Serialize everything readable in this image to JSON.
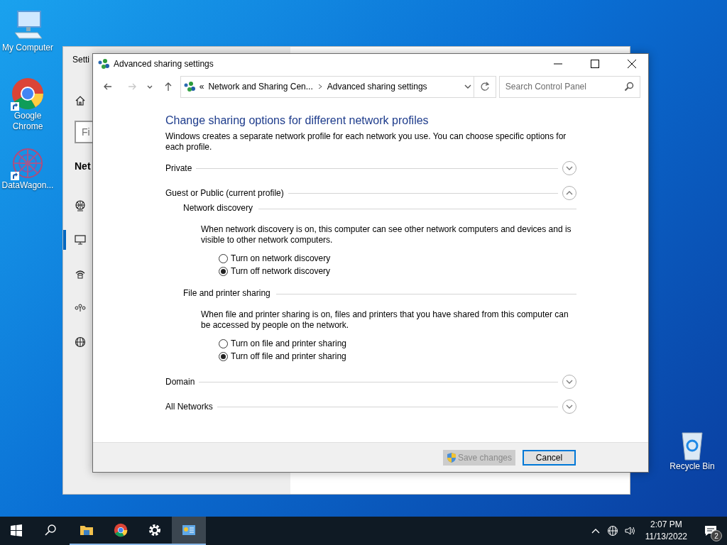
{
  "desktop_icons": [
    {
      "kind": "computer",
      "label": "My Computer"
    },
    {
      "kind": "chrome",
      "label": "Google Chrome",
      "shortcut": true
    },
    {
      "kind": "app",
      "label": "DataWagon...",
      "shortcut": true
    },
    {
      "kind": "recycle",
      "label": "Recycle Bin",
      "shortcut": false
    }
  ],
  "settings_window": {
    "title": "Setti",
    "search_placeholder": "Fi",
    "heading": "Net",
    "nav_items": [
      {
        "kind": "home",
        "selected": false
      },
      {
        "kind": "globe",
        "selected": false
      },
      {
        "kind": "monitor",
        "selected": true
      },
      {
        "kind": "dialup",
        "selected": false
      },
      {
        "kind": "vpn",
        "selected": false
      },
      {
        "kind": "proxy",
        "selected": false
      }
    ]
  },
  "window": {
    "title": "Advanced sharing settings",
    "nav": [
      {
        "kind": "back",
        "disabled": false
      },
      {
        "kind": "forward",
        "disabled": true
      },
      {
        "kind": "recent",
        "disabled": false
      },
      {
        "kind": "up",
        "disabled": false
      }
    ],
    "breadcrumb_prefix": "«",
    "breadcrumb": [
      "Network and Sharing Cen...",
      "Advanced sharing settings"
    ],
    "search_placeholder": "Search Control Panel",
    "heading": "Change sharing options for different network profiles",
    "description": "Windows creates a separate network profile for each network you use. You can choose specific options for each profile.",
    "sections": [
      {
        "label": "Private",
        "expanded": false
      },
      {
        "label": "Guest or Public (current profile)",
        "expanded": true,
        "groups": [
          {
            "title": "Network discovery",
            "description": "When network discovery is on, this computer can see other network computers and devices and is visible to other network computers.",
            "options": [
              {
                "label": "Turn on network discovery",
                "selected": false
              },
              {
                "label": "Turn off network discovery",
                "selected": true
              }
            ]
          },
          {
            "title": "File and printer sharing",
            "description": "When file and printer sharing is on, files and printers that you have shared from this computer can be accessed by people on the network.",
            "options": [
              {
                "label": "Turn on file and printer sharing",
                "selected": false
              },
              {
                "label": "Turn off file and printer sharing",
                "selected": true
              }
            ]
          }
        ]
      },
      {
        "label": "Domain",
        "expanded": false
      },
      {
        "label": "All Networks",
        "expanded": false
      }
    ],
    "buttons": [
      {
        "label": "Save changes",
        "kind": "shield",
        "disabled": true
      },
      {
        "label": "Cancel",
        "kind": "plain",
        "disabled": false
      }
    ]
  },
  "taskbar": {
    "items": [
      {
        "kind": "start",
        "running": false,
        "active": false
      },
      {
        "kind": "search",
        "running": false,
        "active": false
      },
      {
        "kind": "explorer",
        "running": true,
        "active": false
      },
      {
        "kind": "chrome",
        "running": true,
        "active": false
      },
      {
        "kind": "settings",
        "running": true,
        "active": false
      },
      {
        "kind": "controlpanel",
        "running": true,
        "active": true
      }
    ],
    "tray": {
      "time": "2:07 PM",
      "date": "11/13/2022",
      "notifications": "2"
    }
  }
}
